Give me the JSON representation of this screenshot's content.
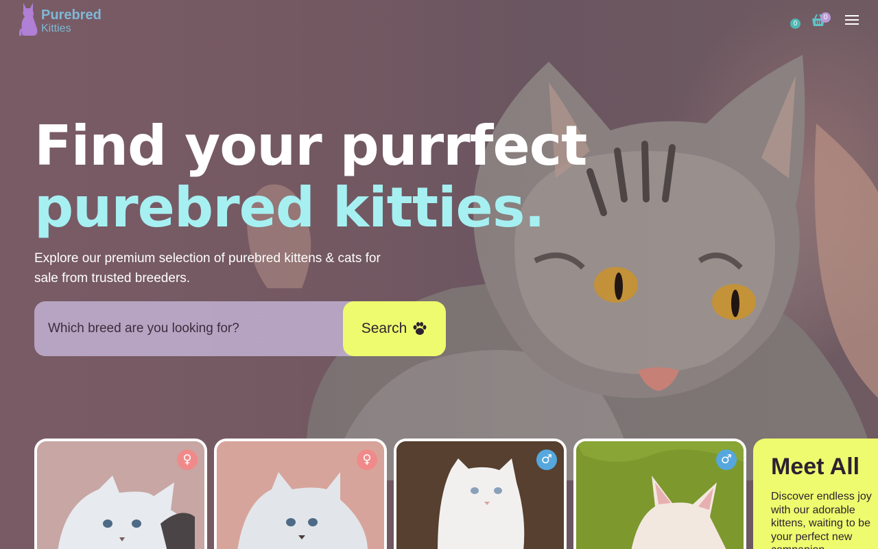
{
  "brand": {
    "name_top": "Purebred",
    "name_bottom": "Kitties"
  },
  "header": {
    "wishlist_count": "0",
    "cart_count": "0",
    "menu_icon": "hamburger-icon"
  },
  "hero": {
    "title_line1": "Find your purrfect",
    "title_line2": "purebred kitties.",
    "subtitle": "Explore our premium selection of purebred kittens & cats for sale from trusted breeders."
  },
  "search": {
    "placeholder": "Which breed are you looking for?",
    "button_label": "Search",
    "button_icon": "paw-icon"
  },
  "cards": [
    {
      "gender": "female",
      "gender_symbol": "♀",
      "bg": "#c9a9a6"
    },
    {
      "gender": "female",
      "gender_symbol": "♀",
      "bg": "#d9a59c"
    },
    {
      "gender": "male",
      "gender_symbol": "♂",
      "bg": "#5a4136"
    },
    {
      "gender": "male",
      "gender_symbol": "♂",
      "bg": "#7f9a2e"
    }
  ],
  "meet": {
    "title": "Meet All",
    "text": "Discover endless joy with our adorable kittens, waiting to be your perfect new companion."
  },
  "colors": {
    "accent_yellow": "#eefb6e",
    "accent_cyan": "#a6f0f2",
    "badge_teal": "#4fb9b4",
    "badge_purple": "#b99ad8",
    "female_badge": "#f08a8a",
    "male_badge": "#55a7de"
  }
}
